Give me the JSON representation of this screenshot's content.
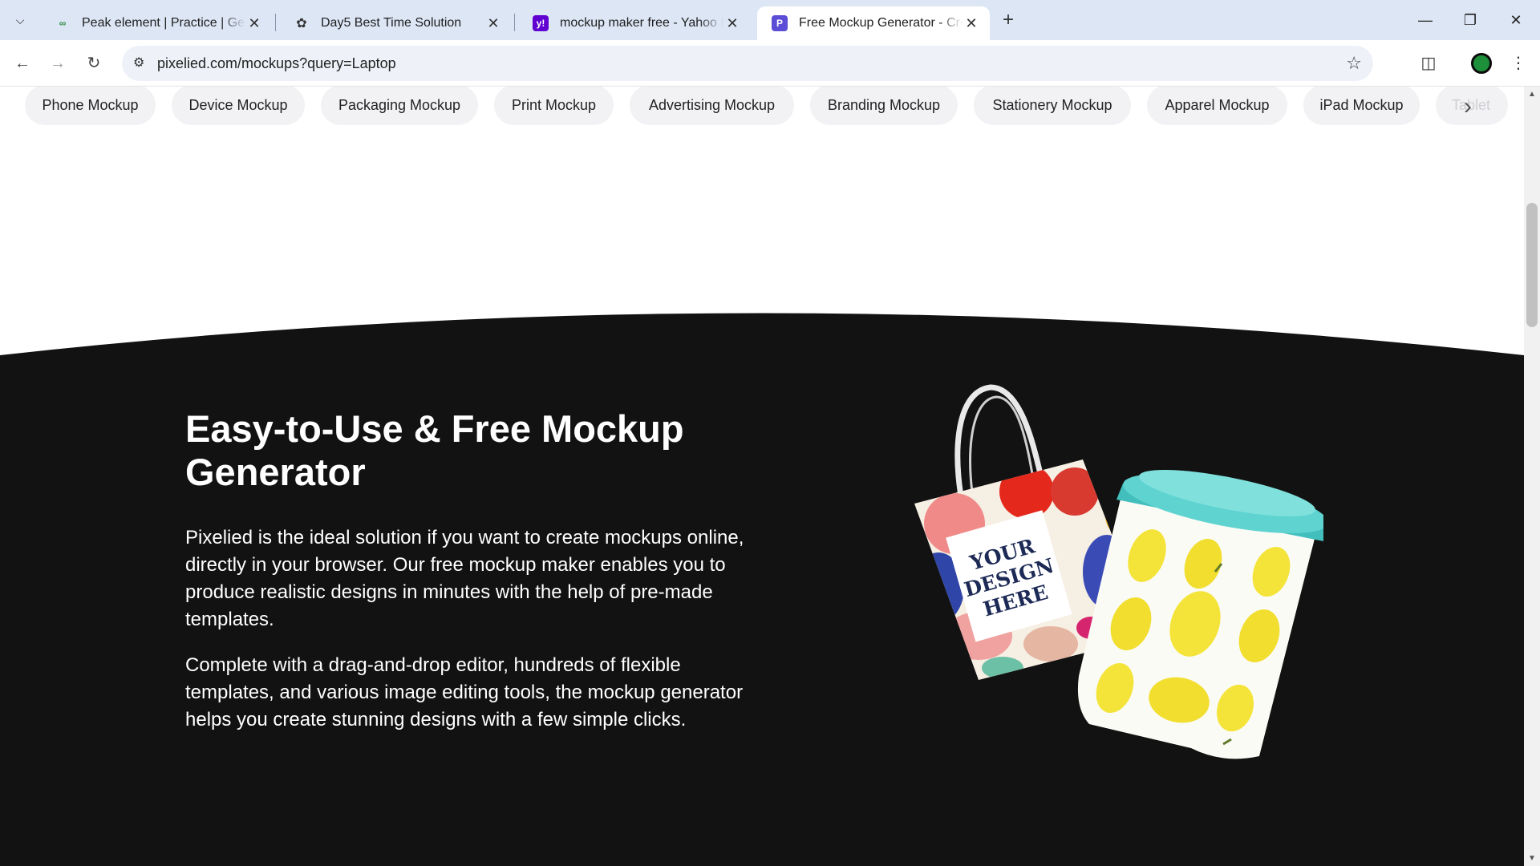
{
  "browser": {
    "tabs": [
      {
        "title": "Peak element | Practice | GeeksforGeeks",
        "favicon": "gfg-icon",
        "active": false
      },
      {
        "title": "Day5 Best Time Solution",
        "favicon": "openai-icon",
        "active": false
      },
      {
        "title": "mockup maker free - Yahoo India Search",
        "favicon": "yahoo-icon",
        "active": false
      },
      {
        "title": "Free Mockup Generator - Create Mockups",
        "favicon": "pixelied-icon",
        "active": true
      }
    ],
    "url": "pixelied.com/mockups?query=Laptop"
  },
  "categories": [
    "Phone Mockup",
    "Device Mockup",
    "Packaging Mockup",
    "Print Mockup",
    "Advertising Mockup",
    "Branding Mockup",
    "Stationery Mockup",
    "Apparel Mockup",
    "iPad Mockup",
    "Tablet"
  ],
  "hero": {
    "heading": "Easy-to-Use & Free Mockup Generator",
    "paragraph1": "Pixelied is the ideal solution if you want to create mockups online, directly in your browser. Our free mockup maker enables you to produce realistic designs in minutes with the help of pre-made templates.",
    "paragraph2": "Complete with a drag-and-drop editor, hundreds of flexible templates, and various image editing tools, the mockup generator helps you create stunning designs with a few simple clicks.",
    "bag_text": [
      "YOUR",
      "DESIGN",
      "HERE"
    ]
  },
  "colors": {
    "dark_bg": "#121212",
    "tab_strip": "#dce6f5",
    "chip_bg": "#f2f2f4",
    "cup_lid": "#5fd3d0",
    "lemon": "#f4e43a"
  }
}
